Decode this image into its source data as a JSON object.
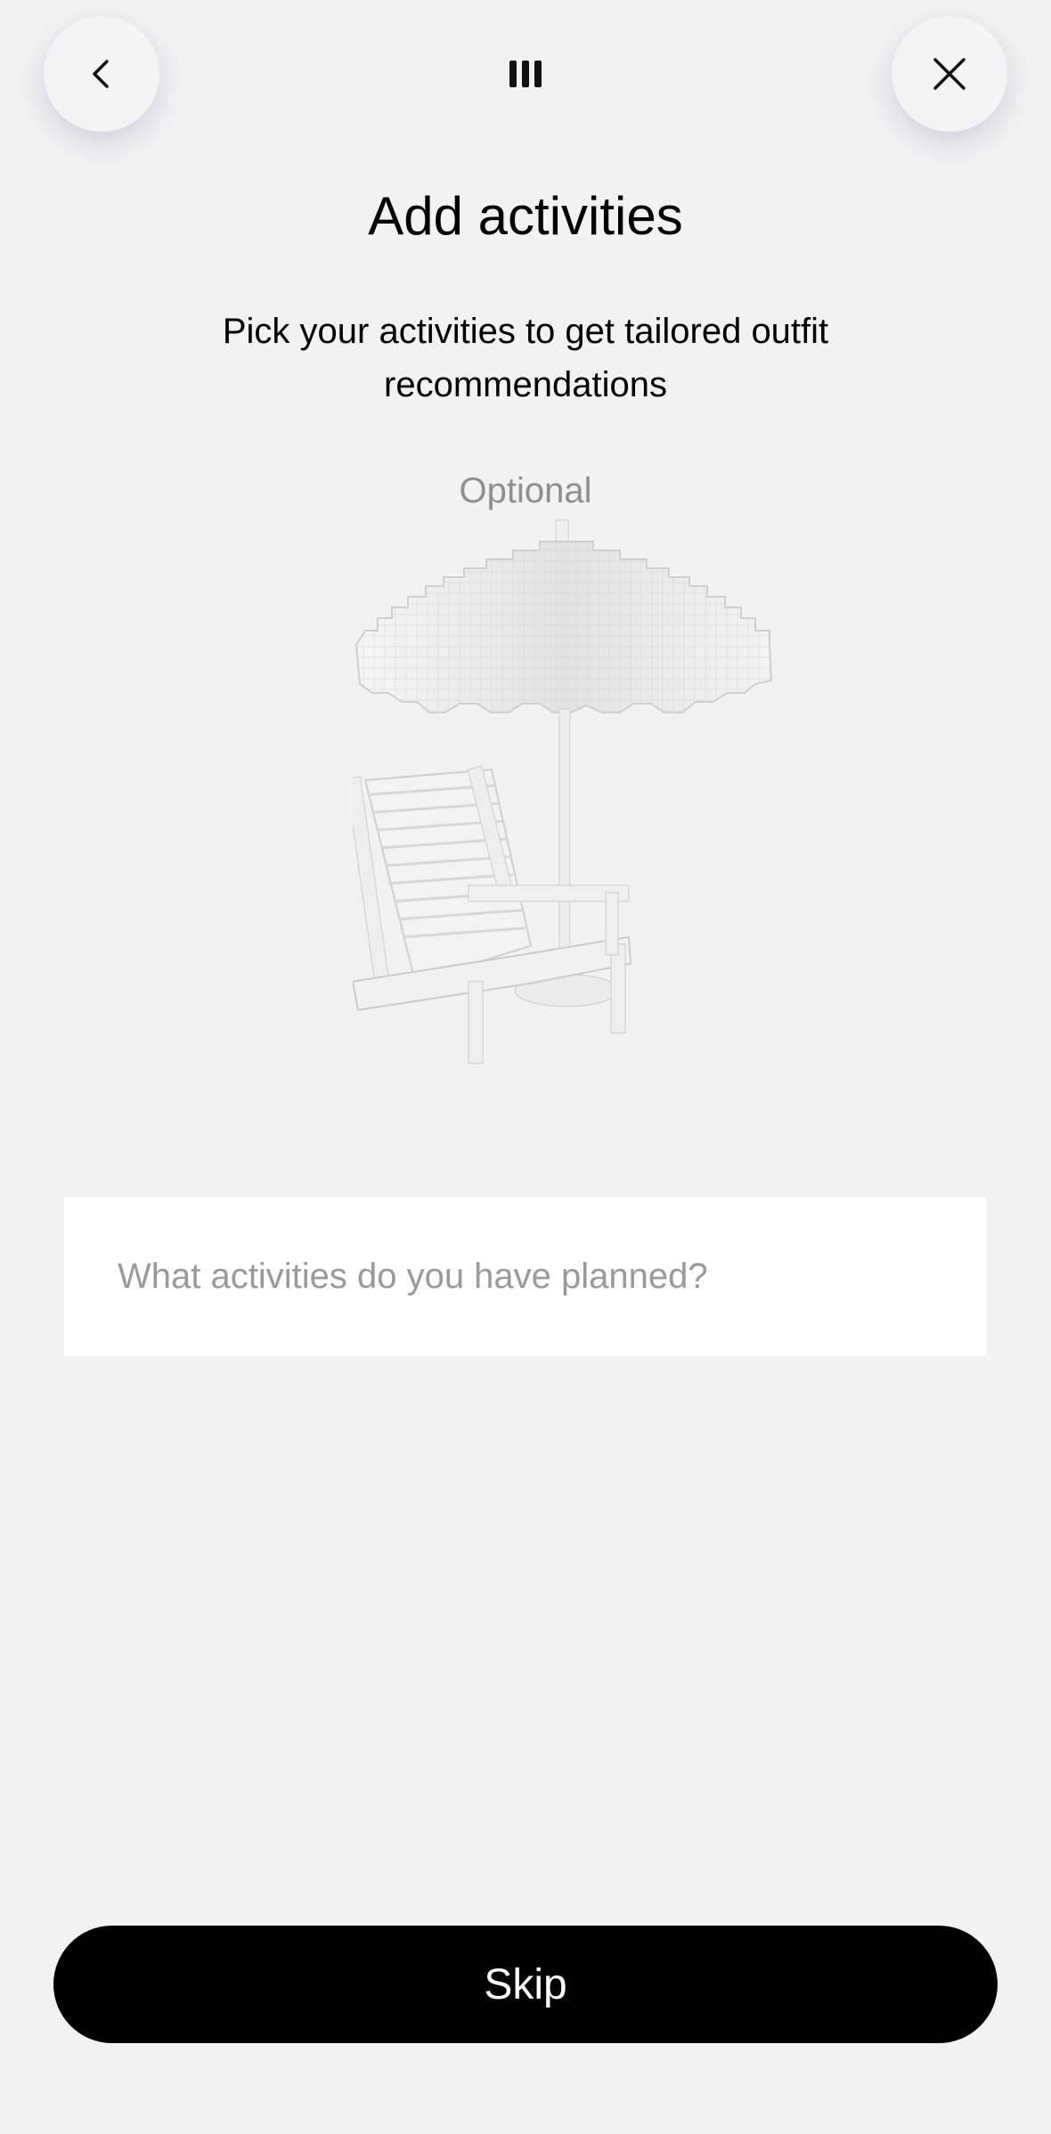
{
  "header": {
    "back_icon": "chevron-left-icon",
    "close_icon": "close-icon",
    "progress_icon": "progress-bars-icon"
  },
  "main": {
    "title": "Add activities",
    "subtitle": "Pick your activities to get tailored outfit recommendations",
    "optional_label": "Optional",
    "illustration": "beach-umbrella-and-chair-icon",
    "activities_input": {
      "placeholder": "What activities do you have planned?",
      "value": ""
    }
  },
  "footer": {
    "skip_label": "Skip"
  },
  "colors": {
    "background": "#f2f2f2",
    "primary_button": "#000000",
    "muted_text": "#8f8f8f"
  }
}
